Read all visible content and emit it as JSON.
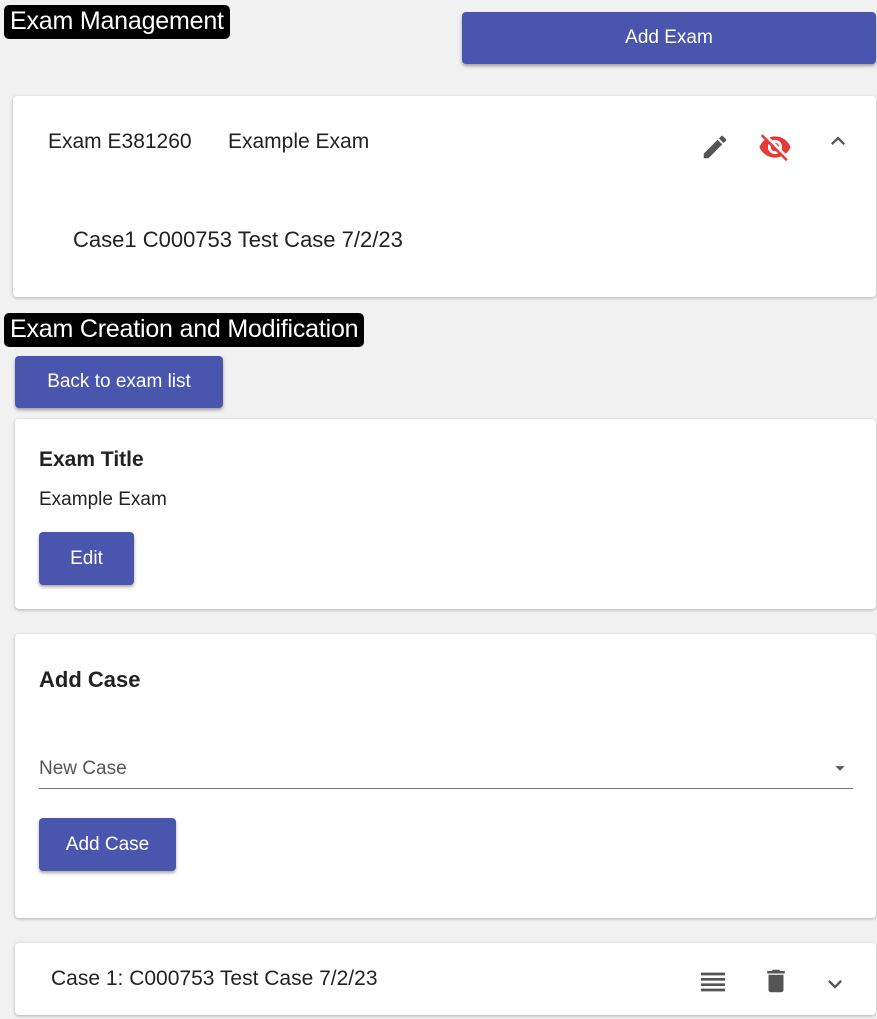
{
  "exam_management": {
    "section_label": "Exam Management",
    "add_exam_label": "Add Exam",
    "exam_card": {
      "exam_id": "Exam E381260",
      "exam_name": "Example Exam",
      "case_line": "Case1 C000753 Test Case 7/2/23",
      "icons": [
        "edit-pencil-icon",
        "visibility-off-icon",
        "chevron-up-icon"
      ],
      "visibility_off_color": "#e53935"
    }
  },
  "exam_creation": {
    "section_label": "Exam Creation and Modification",
    "back_label": "Back to exam list",
    "title_card": {
      "heading": "Exam Title",
      "value": "Example Exam",
      "edit_label": "Edit"
    },
    "add_case_card": {
      "heading": "Add Case",
      "select_value": "New Case",
      "add_case_label": "Add Case"
    },
    "case_row": {
      "label": "Case 1: C000753 Test Case 7/2/23",
      "icons": [
        "reorder-icon",
        "trash-icon",
        "chevron-down-icon"
      ]
    }
  },
  "colors": {
    "primary": "#4a56ad",
    "background": "#f1f1f1",
    "icon_gray": "#555555"
  }
}
